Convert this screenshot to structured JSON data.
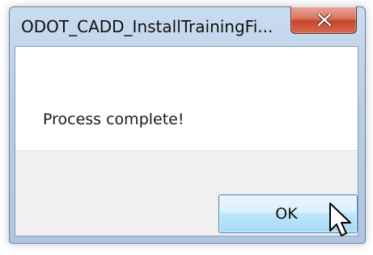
{
  "window": {
    "title": "ODOT_CADD_InstallTrainingFi...",
    "close_icon": "close-x-icon"
  },
  "dialog": {
    "message": "Process complete!",
    "ok_label": "OK"
  },
  "colors": {
    "close_button": "#c8452b",
    "ok_button_border": "#3c7fb1",
    "button_bar": "#f0f0f0",
    "frame": "#b9cfe8"
  }
}
